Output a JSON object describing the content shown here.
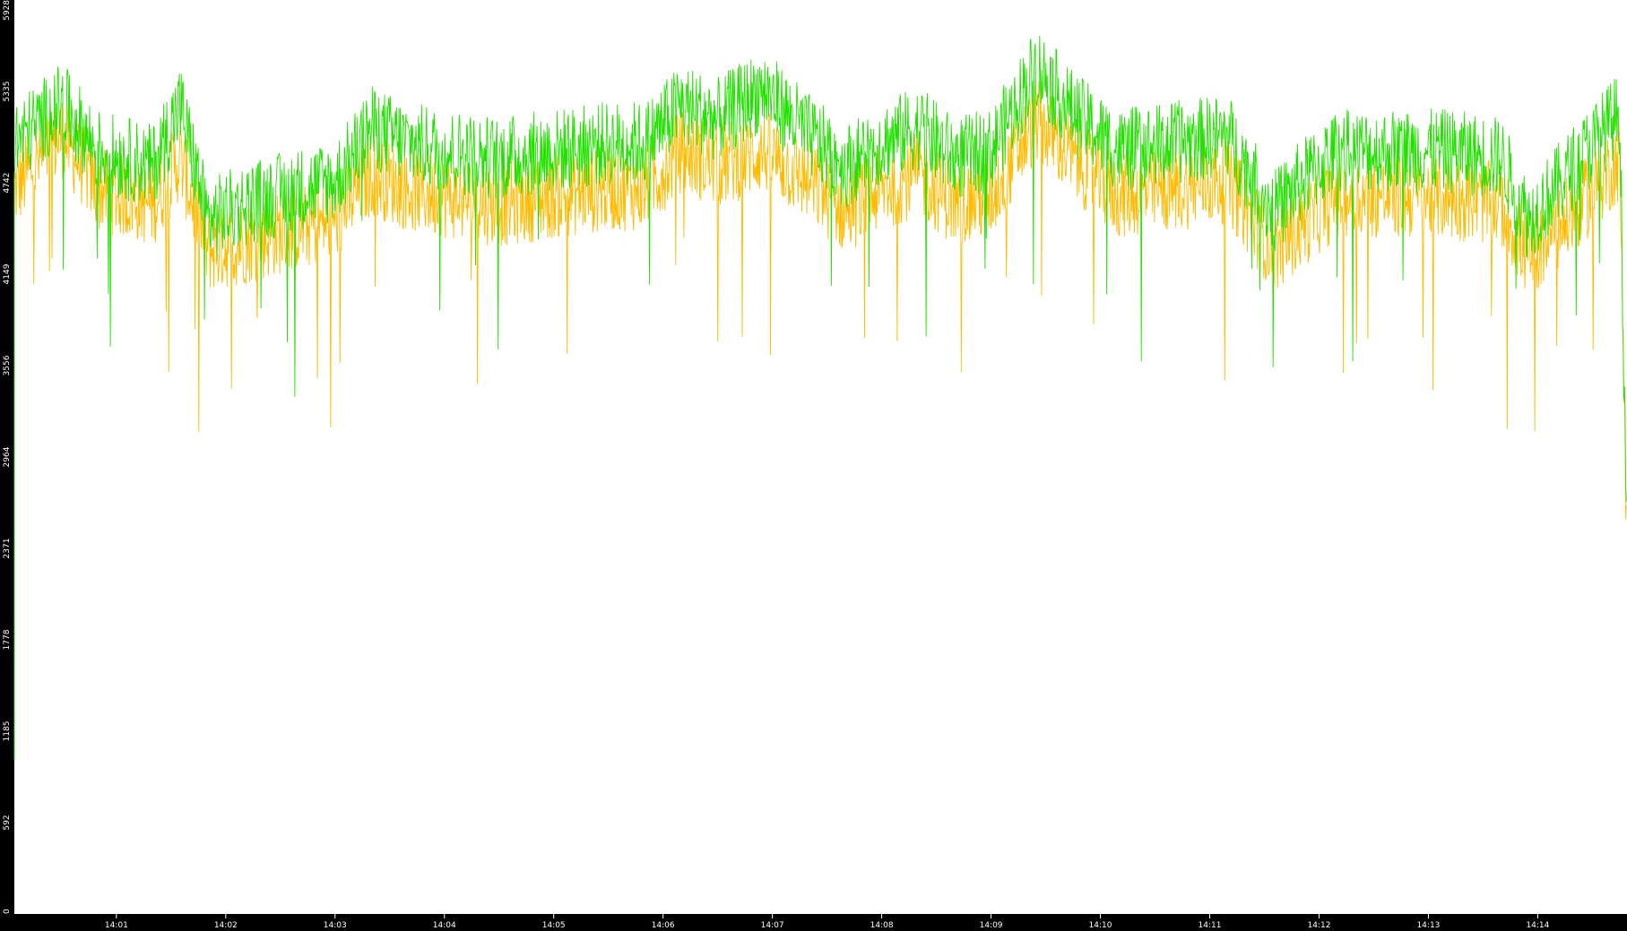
{
  "chart_data": {
    "type": "line",
    "title": "",
    "xlabel": "",
    "ylabel": "",
    "ylim": [
      0,
      5928
    ],
    "y_ticks": [
      "0",
      "592",
      "1185",
      "1778",
      "2371",
      "2964",
      "3556",
      "4149",
      "4742",
      "5335",
      "5928"
    ],
    "x_ticks": [
      "14:01",
      "14:02",
      "14:03",
      "14:04",
      "14:05",
      "14:06",
      "14:07",
      "14:08",
      "14:09",
      "14:10",
      "14:11",
      "14:12",
      "14:13",
      "14:14"
    ],
    "x_range": [
      "14:00:04",
      "14:14:49"
    ],
    "grid": false,
    "legend": "none",
    "colors": {
      "background": "#ffffff",
      "frame": "#000000",
      "tick_text": "#ffffff",
      "series_green": "#22e000",
      "series_orange": "#ffbb00"
    },
    "series": [
      {
        "color": "series_green",
        "x": [
          "14:00:04",
          "14:00:30",
          "14:00:50",
          "14:01:20",
          "14:01:35",
          "14:01:50",
          "14:02:10",
          "14:02:40",
          "14:03:00",
          "14:03:20",
          "14:03:40",
          "14:04:00",
          "14:04:30",
          "14:05:00",
          "14:05:30",
          "14:05:50",
          "14:06:10",
          "14:06:30",
          "14:06:55",
          "14:07:20",
          "14:07:40",
          "14:08:00",
          "14:08:20",
          "14:08:40",
          "14:09:00",
          "14:09:25",
          "14:09:45",
          "14:10:10",
          "14:10:40",
          "14:11:10",
          "14:11:35",
          "14:11:50",
          "14:12:10",
          "14:12:40",
          "14:13:10",
          "14:13:40",
          "14:13:55",
          "14:14:20",
          "14:14:45",
          "14:14:49"
        ],
        "y": [
          5000,
          5250,
          4950,
          4850,
          5250,
          4500,
          4600,
          4700,
          4750,
          5100,
          5000,
          4950,
          4900,
          4950,
          5000,
          5000,
          5250,
          5150,
          5350,
          5050,
          4850,
          5000,
          5100,
          4900,
          4950,
          5500,
          5200,
          4950,
          5000,
          5050,
          4550,
          4750,
          4950,
          4950,
          4950,
          4900,
          4500,
          4850,
          5200,
          2400
        ]
      },
      {
        "color": "series_orange",
        "x": [
          "14:00:04",
          "14:00:30",
          "14:00:50",
          "14:01:20",
          "14:01:35",
          "14:01:50",
          "14:02:10",
          "14:02:40",
          "14:03:00",
          "14:03:20",
          "14:03:40",
          "14:04:00",
          "14:04:30",
          "14:05:00",
          "14:05:30",
          "14:05:50",
          "14:06:10",
          "14:06:30",
          "14:06:55",
          "14:07:20",
          "14:07:40",
          "14:08:00",
          "14:08:20",
          "14:08:40",
          "14:09:00",
          "14:09:25",
          "14:09:45",
          "14:10:10",
          "14:10:40",
          "14:11:10",
          "14:11:35",
          "14:11:50",
          "14:12:10",
          "14:12:40",
          "14:13:10",
          "14:13:40",
          "14:13:55",
          "14:14:20",
          "14:14:45",
          "14:14:49"
        ],
        "y": [
          4700,
          5050,
          4700,
          4600,
          4900,
          4300,
          4350,
          4450,
          4500,
          4800,
          4700,
          4650,
          4600,
          4650,
          4700,
          4700,
          4950,
          4850,
          4950,
          4750,
          4550,
          4700,
          4800,
          4600,
          4650,
          5150,
          4900,
          4650,
          4700,
          4750,
          4300,
          4450,
          4650,
          4650,
          4650,
          4600,
          4250,
          4550,
          4900,
          2400
        ]
      }
    ]
  }
}
